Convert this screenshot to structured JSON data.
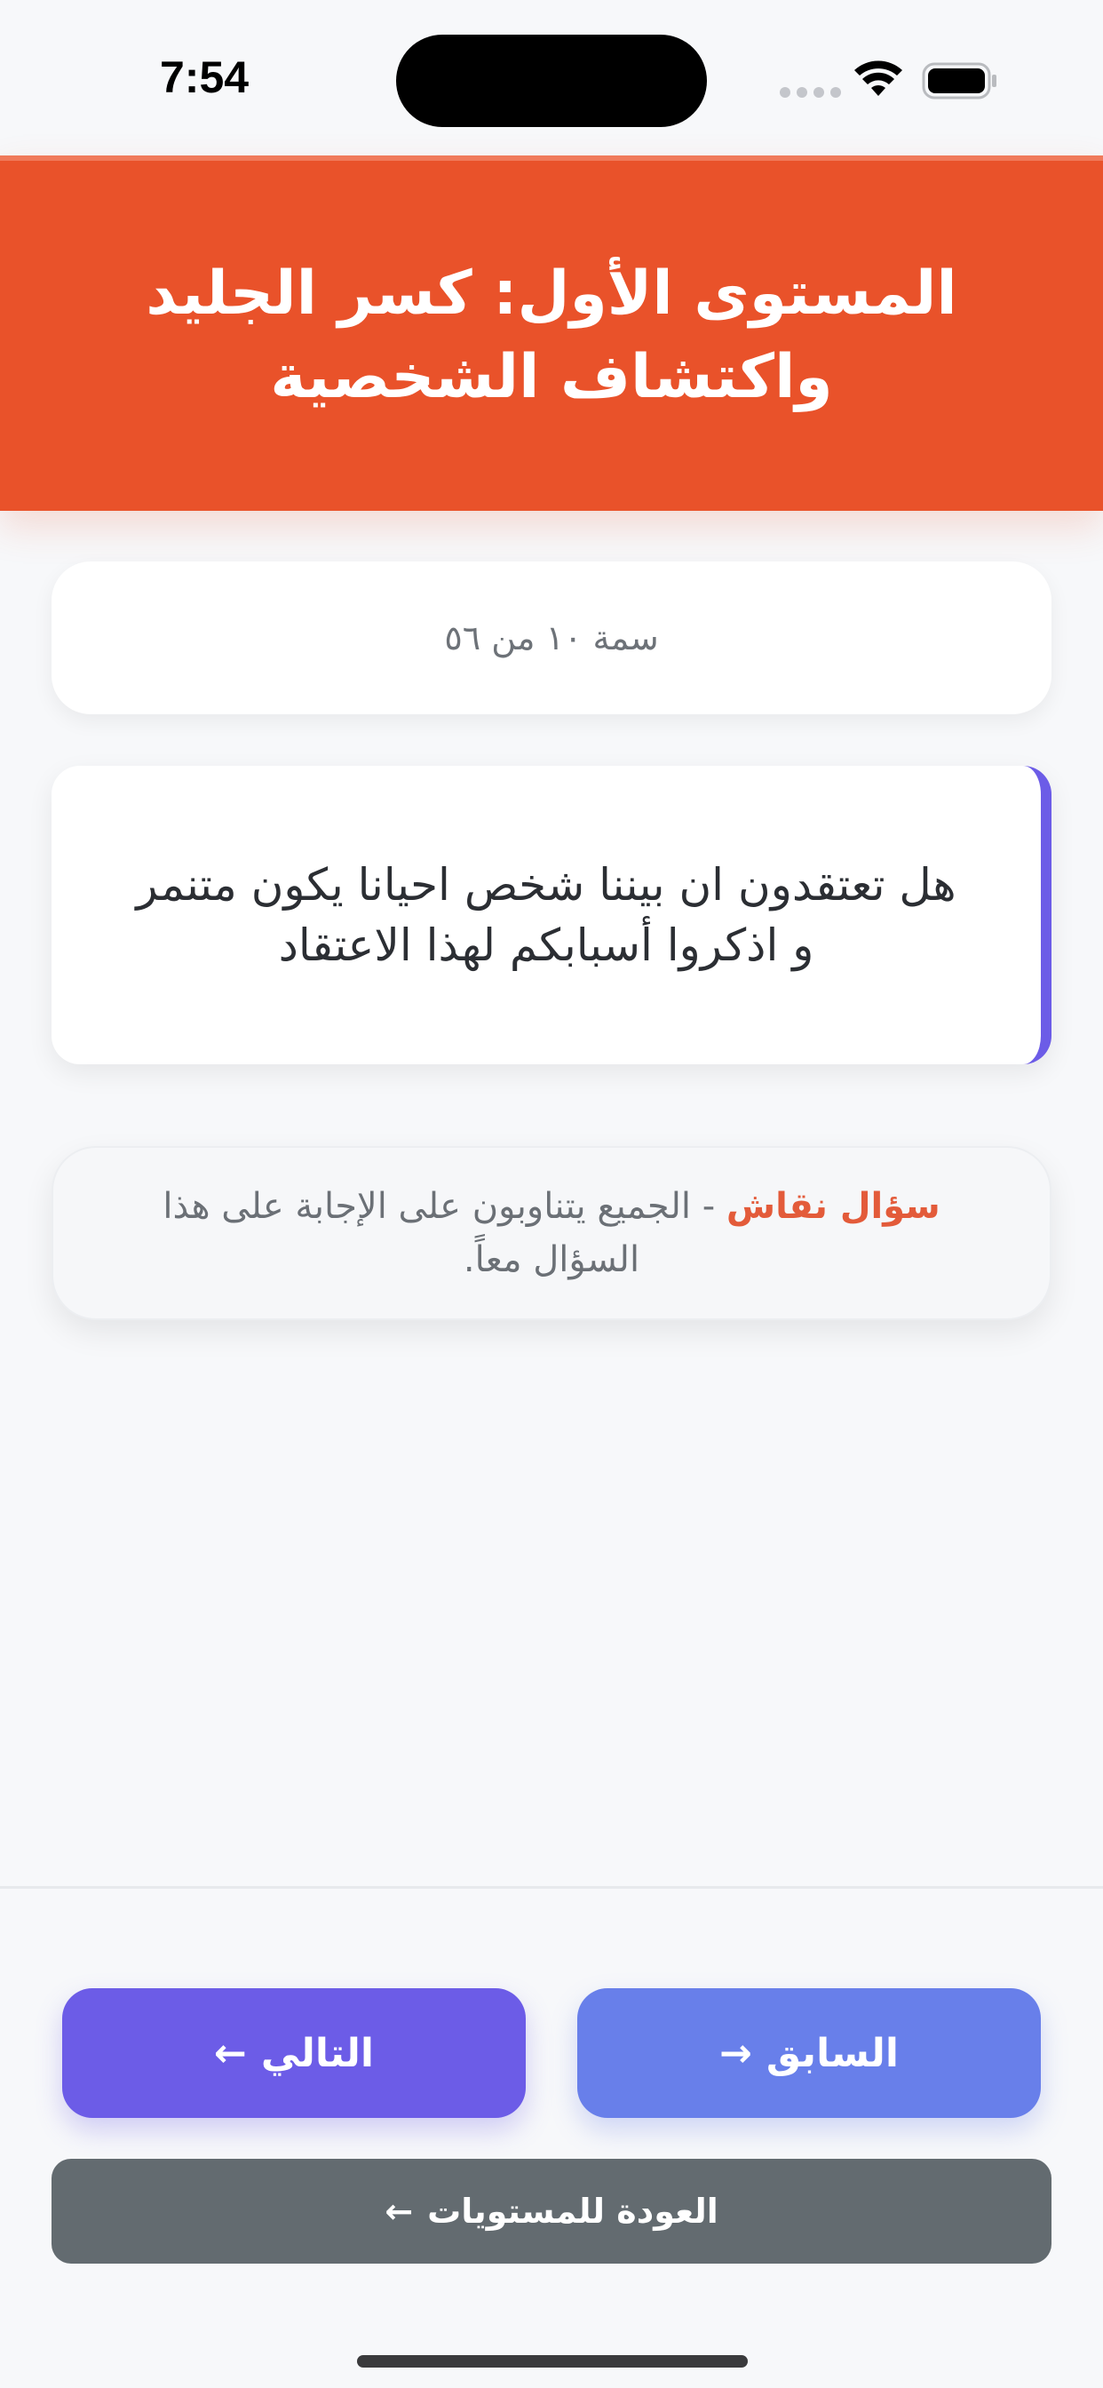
{
  "status_bar": {
    "time": "7:54"
  },
  "header": {
    "title": "المستوى الأول: كسر الجليد واكتشاف الشخصية"
  },
  "counter": {
    "text": "سمة ١٠ من ٥٦"
  },
  "question": {
    "text": "هل تعتقدون ان بيننا شخص  احيانا يكون متنمر  و اذكروا أسبابكم  لهذا الاعتقاد"
  },
  "hint": {
    "title": "سؤال نقاش",
    "separator": " - ",
    "body": "الجميع يتناوبون على الإجابة على هذا السؤال معاً."
  },
  "buttons": {
    "next_label": "التالي",
    "next_arrow": "←",
    "prev_label": "السابق",
    "prev_arrow": "→",
    "back_label": "العودة للمستويات",
    "back_arrow": "←"
  },
  "colors": {
    "header": "#e9522a",
    "accent_purple": "#6c5ce7",
    "accent_blue": "#687fea",
    "back_gray": "#636b70",
    "hint_title": "#e35b3a"
  },
  "icons": [
    "wifi-icon",
    "battery-icon",
    "cellular-signal-icon",
    "arrow-left-icon",
    "arrow-right-icon"
  ]
}
